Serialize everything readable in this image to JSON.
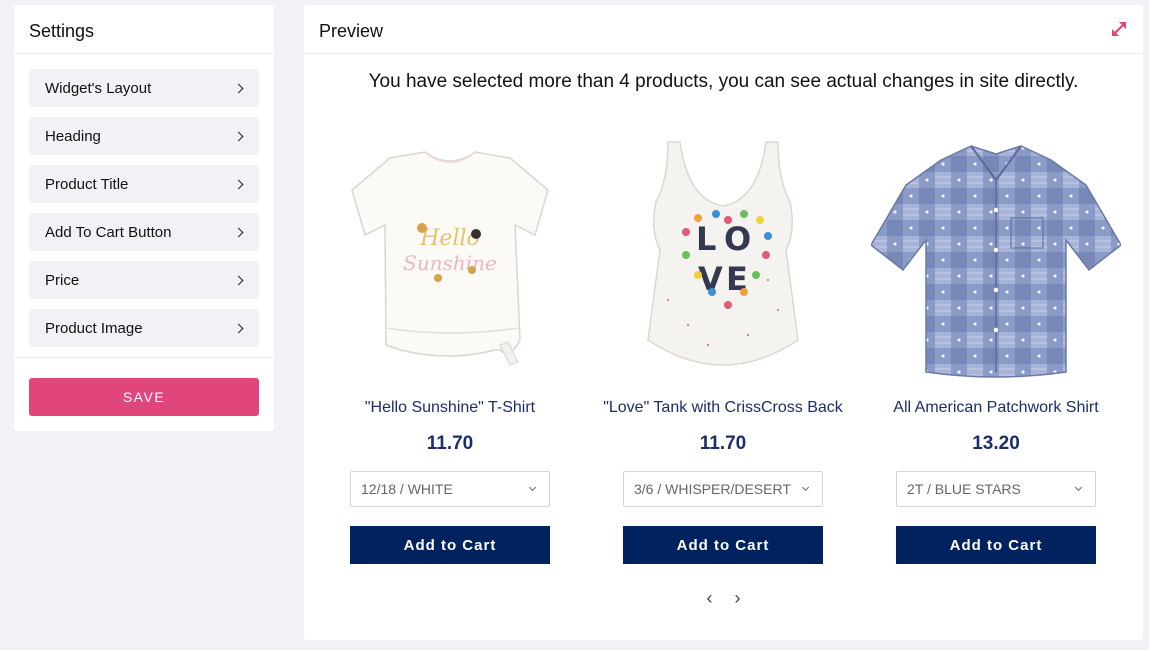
{
  "settings": {
    "title": "Settings",
    "items": [
      {
        "label": "Widget's Layout"
      },
      {
        "label": "Heading"
      },
      {
        "label": "Product Title"
      },
      {
        "label": "Add To Cart Button"
      },
      {
        "label": "Price"
      },
      {
        "label": "Product Image"
      }
    ],
    "save_label": "SAVE"
  },
  "preview": {
    "title": "Preview",
    "notice": "You have selected more than 4 products, you can see actual changes in site directly.",
    "products": [
      {
        "title": "\"Hello Sunshine\" T-Shirt",
        "price": "11.70",
        "variant": "12/18 / WHITE",
        "button": "Add to Cart",
        "image": "white-tshirt-image"
      },
      {
        "title": "\"Love\" Tank with CrissCross Back",
        "price": "11.70",
        "variant": "3/6 / WHISPER/DESERT",
        "button": "Add to Cart",
        "image": "love-tank-image"
      },
      {
        "title": "All American Patchwork Shirt",
        "price": "13.20",
        "variant": "2T / BLUE STARS",
        "button": "Add to Cart",
        "image": "patchwork-shirt-image"
      }
    ],
    "pager": {
      "prev": "‹",
      "next": "›"
    }
  },
  "colors": {
    "accent": "#e0457c",
    "button": "#002360",
    "title_text": "#1b2e6b",
    "background": "#f1f1f6"
  },
  "icons": {
    "expand": "expand-arrows-icon",
    "chevron_right": "chevron-right-icon",
    "chevron_down": "chevron-down-icon"
  }
}
